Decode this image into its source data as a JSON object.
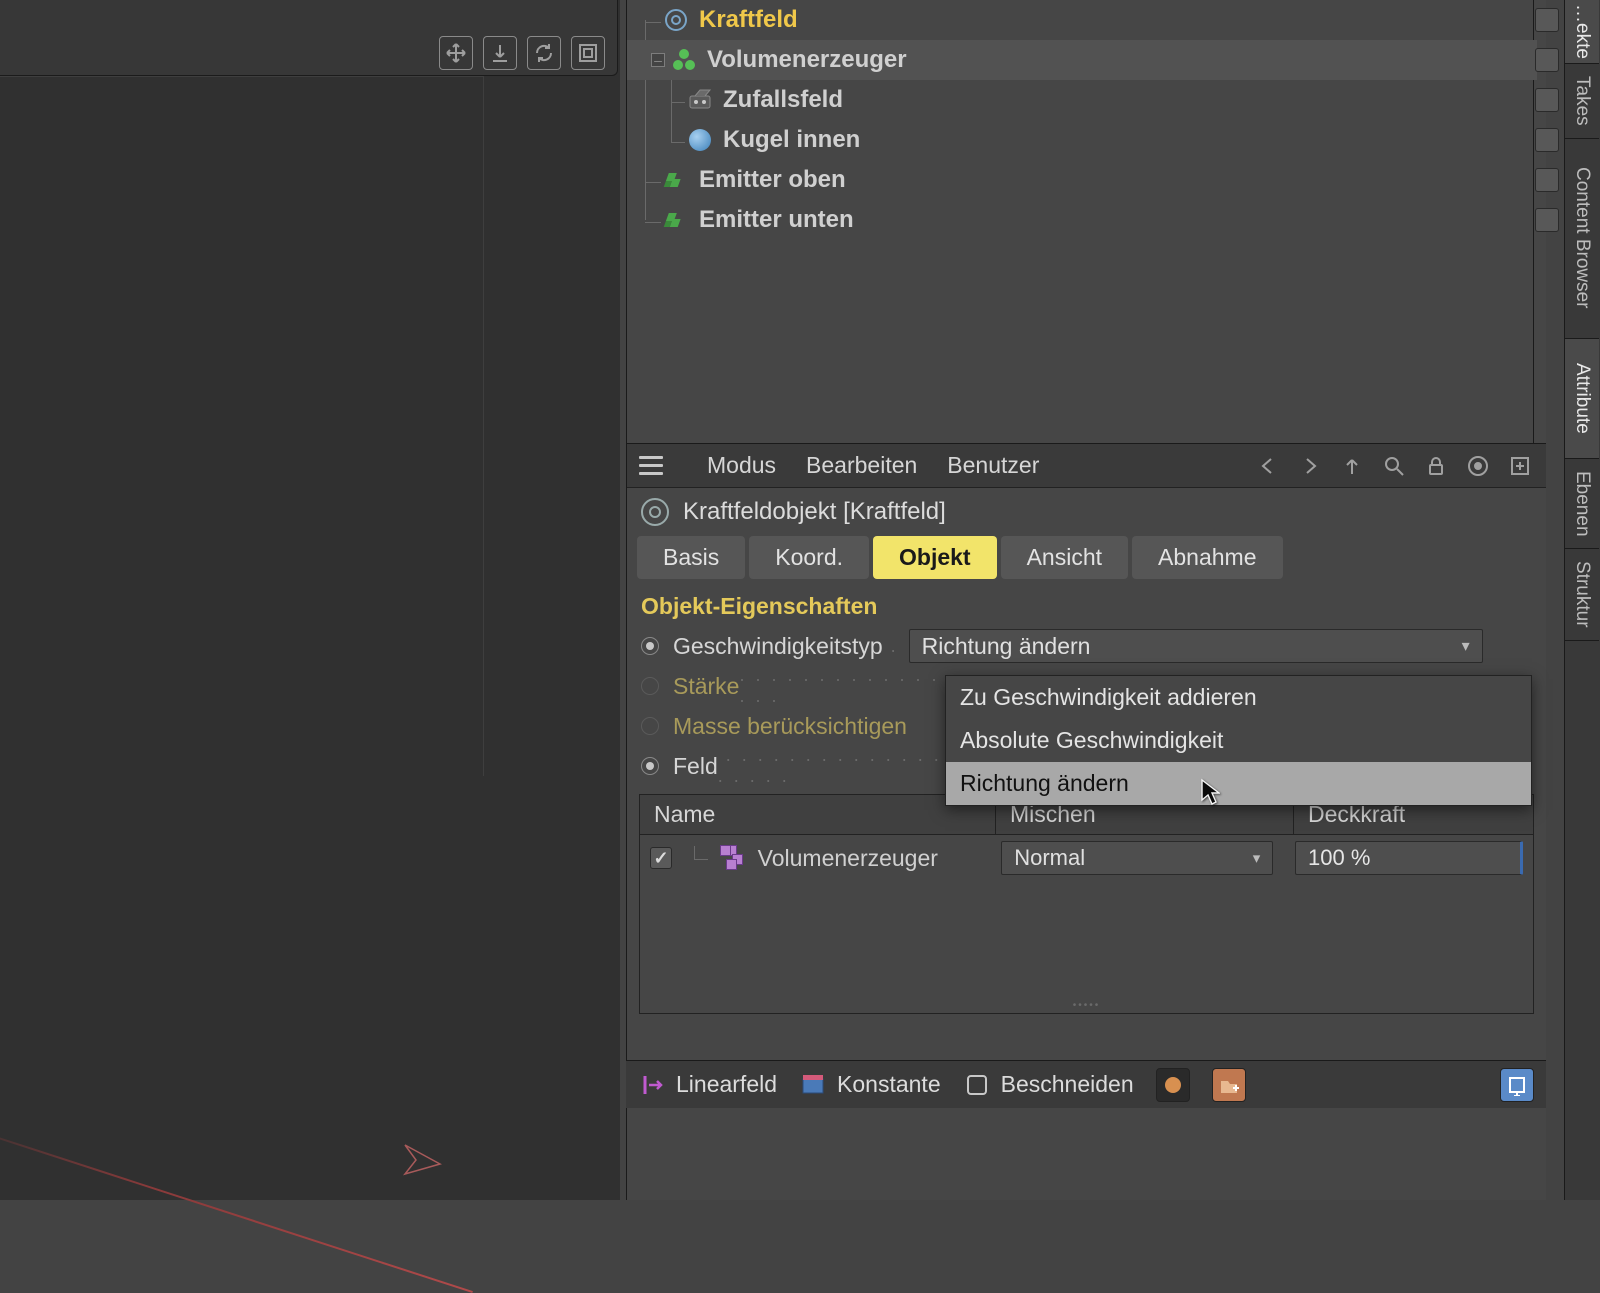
{
  "viewport_tools": [
    "move",
    "drop",
    "refresh",
    "frame"
  ],
  "object_tree": [
    {
      "name": "Kraftfeld",
      "depth": 0,
      "icon": "target",
      "active": true,
      "expander": " "
    },
    {
      "name": "Volumenerzeuger",
      "depth": 0,
      "icon": "volgen",
      "expander": "–",
      "selected": true
    },
    {
      "name": "Zufallsfeld",
      "depth": 1,
      "icon": "random"
    },
    {
      "name": "Kugel innen",
      "depth": 1,
      "icon": "sphere",
      "extras": "orange"
    },
    {
      "name": "Emitter oben",
      "depth": 0,
      "icon": "emit"
    },
    {
      "name": "Emitter unten",
      "depth": 0,
      "icon": "emit"
    }
  ],
  "vtabs": [
    {
      "label": "…ekte",
      "active": true
    },
    {
      "label": "Takes"
    },
    {
      "label": "Content Browser"
    },
    {
      "label": "Attribute",
      "active": true
    },
    {
      "label": "Ebenen"
    },
    {
      "label": "Struktur"
    }
  ],
  "attributes": {
    "menu": [
      "Modus",
      "Bearbeiten",
      "Benutzer"
    ],
    "title": "Kraftfeldobjekt [Kraftfeld]",
    "tabs": [
      {
        "label": "Basis"
      },
      {
        "label": "Koord."
      },
      {
        "label": "Objekt",
        "active": true
      },
      {
        "label": "Ansicht"
      },
      {
        "label": "Abnahme"
      }
    ],
    "section_title": "Objekt-Eigenschaften",
    "rows": [
      {
        "label": "Geschwindigkeitstyp",
        "radio": "on",
        "value": "Richtung ändern"
      },
      {
        "label": "Stärke",
        "dim": true
      },
      {
        "label": "Masse berücksichtigen",
        "dim": true
      },
      {
        "label": "Feld",
        "radio": "on"
      }
    ],
    "dropdown_options": [
      {
        "label": "Zu Geschwindigkeit addieren"
      },
      {
        "label": "Absolute Geschwindigkeit"
      },
      {
        "label": "Richtung ändern",
        "highlight": true
      }
    ],
    "field_table": {
      "headers": [
        "Name",
        "Mischen",
        "Deckkraft"
      ],
      "row": {
        "checked": true,
        "name": "Volumenerzeuger",
        "mix": "Normal",
        "opacity": "100 %"
      }
    },
    "bottom_bar": [
      "Linearfeld",
      "Konstante",
      "Beschneiden"
    ]
  }
}
